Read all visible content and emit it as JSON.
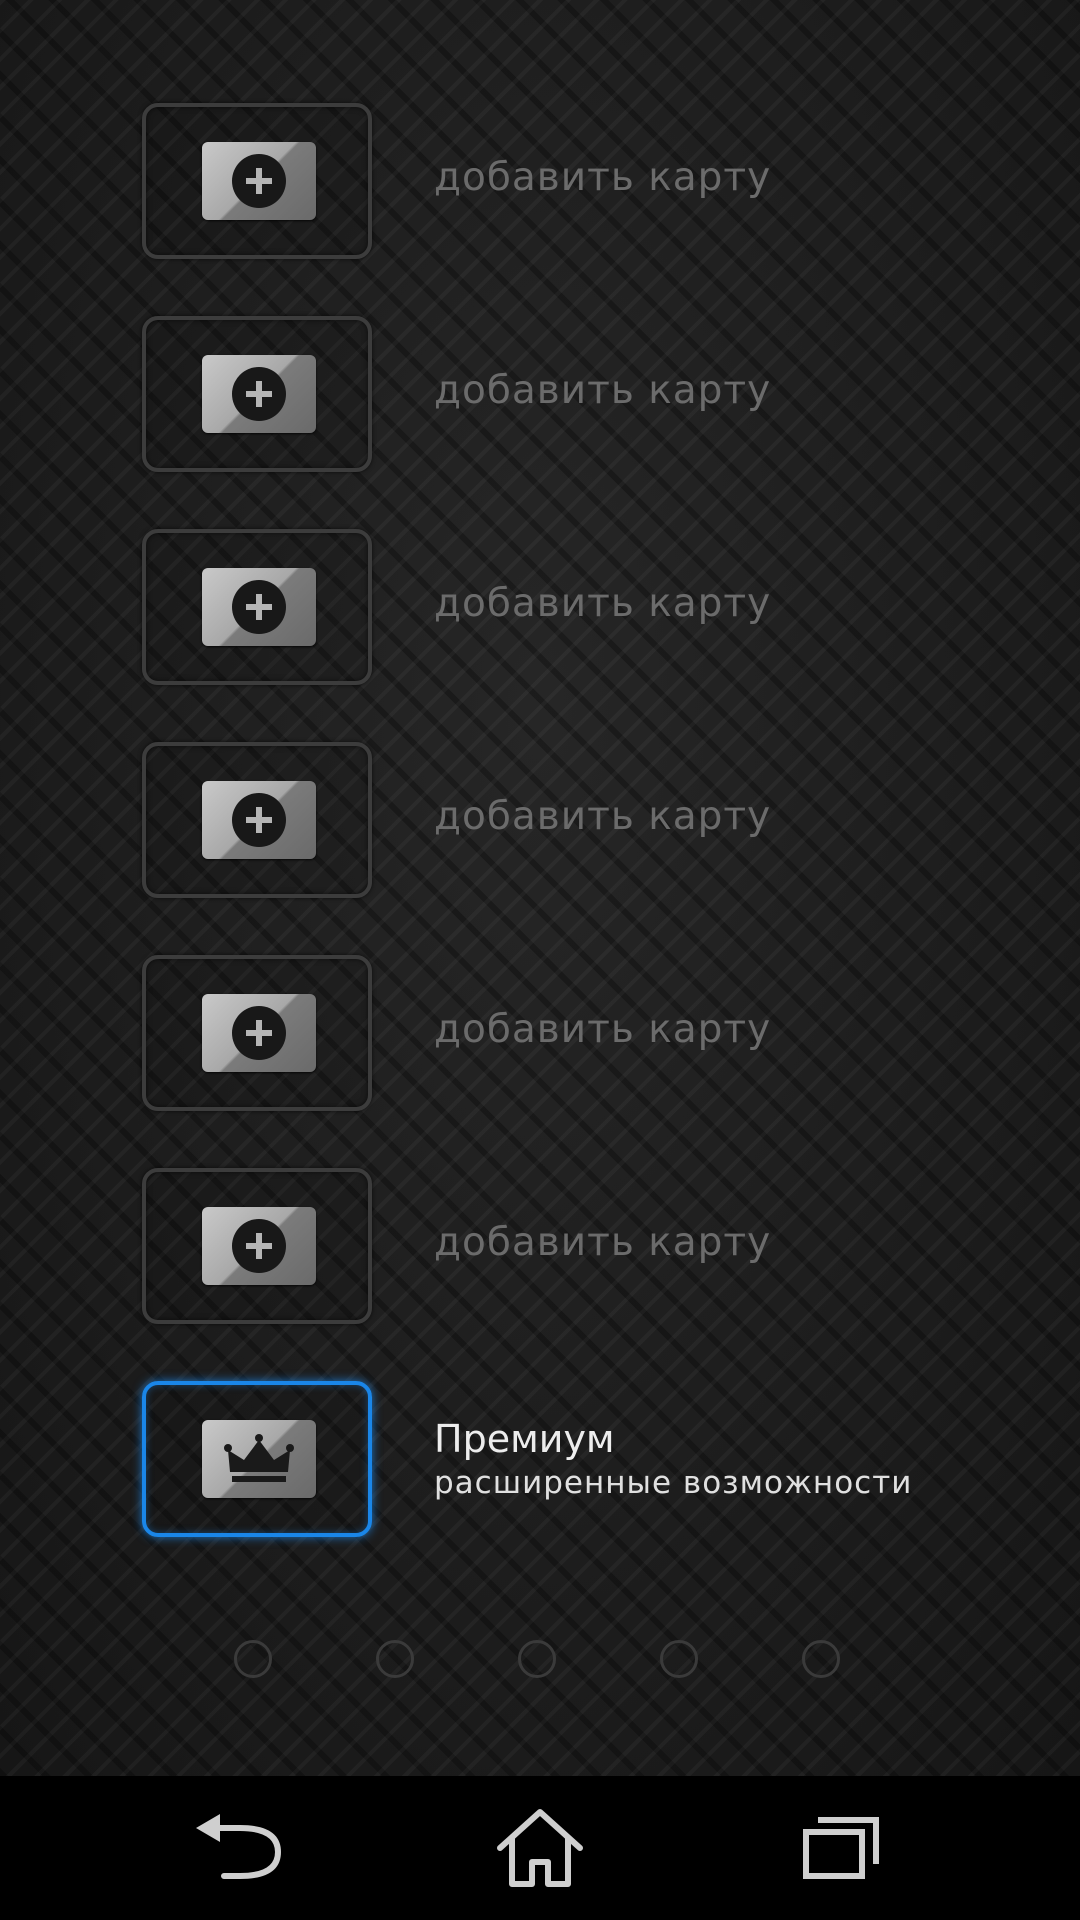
{
  "card_slots": [
    {
      "label": "добавить карту",
      "icon": "add-card-icon"
    },
    {
      "label": "добавить карту",
      "icon": "add-card-icon"
    },
    {
      "label": "добавить карту",
      "icon": "add-card-icon"
    },
    {
      "label": "добавить карту",
      "icon": "add-card-icon"
    },
    {
      "label": "добавить карту",
      "icon": "add-card-icon"
    },
    {
      "label": "добавить карту",
      "icon": "add-card-icon"
    }
  ],
  "premium": {
    "title": "Премиум",
    "subtitle": "расширенные возможности",
    "icon": "crown-icon",
    "accent": "#1a86e8"
  },
  "pager": {
    "pages": 5
  },
  "navbar": {
    "buttons": [
      "back-icon",
      "home-icon",
      "recent-apps-icon"
    ]
  },
  "colors": {
    "background": "#1c1c1c",
    "slot_border": "#3c3c3c",
    "label": "#6b6b6b",
    "premium_text": "#ededed"
  }
}
